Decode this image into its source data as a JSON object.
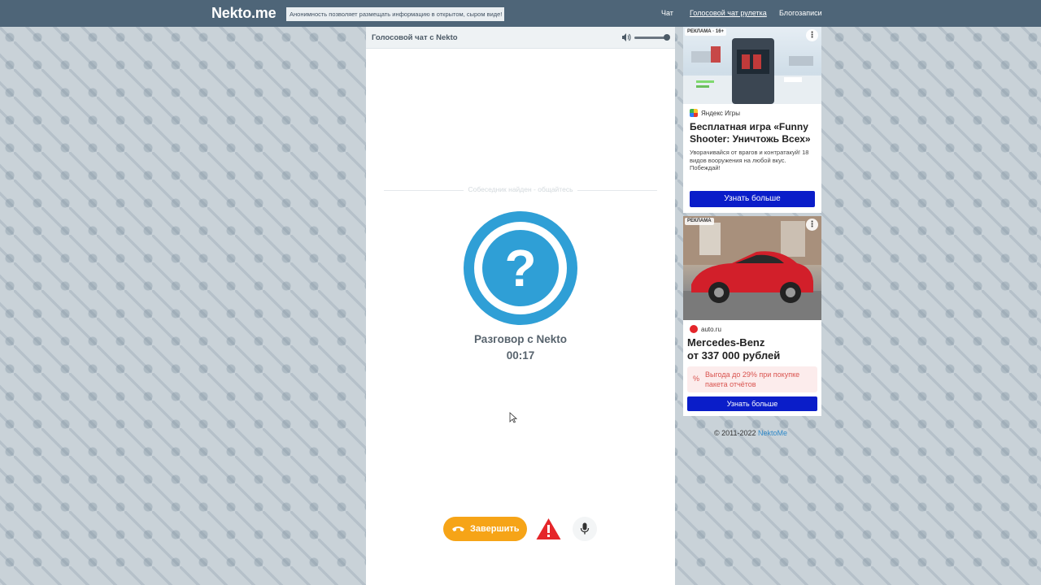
{
  "topbar": {
    "logo": "Nekto.me",
    "notice": "Анонимность позволяет размещать информацию в открытом, сыром виде!",
    "nav": [
      {
        "label": "Чат"
      },
      {
        "label": "Голосовой чат рулетка"
      },
      {
        "label": "Блогозаписи"
      }
    ]
  },
  "chat": {
    "header_title": "Голосовой чат с Nekto",
    "volume_level": 1.0,
    "status_text": "Собеседник найден - общайтесь",
    "avatar_symbol": "?",
    "talk_title": "Разговор с Nekto",
    "talk_time": "00:17",
    "end_label": "Завершить"
  },
  "ads": [
    {
      "badge": "РЕКЛАМА · 16+",
      "source": "Яндекс Игры",
      "title": "Бесплатная игра «Funny Shooter: Уничтожь Всех»",
      "description": "Уворачивайся от врагов и контратакуй! 18 видов вооружения на любой вкус. Побеждай!",
      "cta": "Узнать больше"
    },
    {
      "badge": "РЕКЛАМА",
      "source": "auto.ru",
      "title_line1": "Mercedes-Benz",
      "title_line2": "от 337 000 рублей",
      "promo_symbol": "%",
      "promo": "Выгода до 29% при покупке пакета отчётов",
      "cta": "Узнать больше"
    }
  ],
  "footer": {
    "copyright": "© 2011-2022",
    "link": "NektoMe"
  },
  "colors": {
    "topbar": "#4e6578",
    "accent_blue": "#2f9fd6",
    "end_button": "#f6a417",
    "report_red": "#e5262a",
    "ad_cta": "#0a1dc9"
  }
}
